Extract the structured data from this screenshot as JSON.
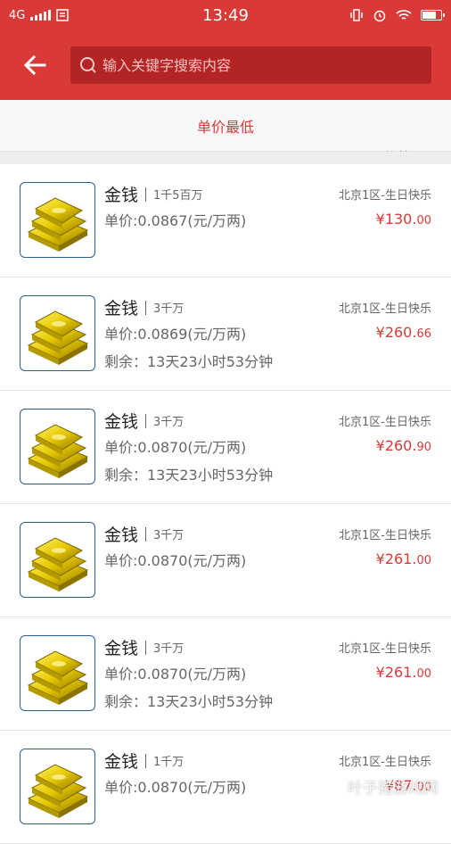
{
  "status_bar": {
    "network": "4G",
    "time": "13:49"
  },
  "search": {
    "placeholder": "输入关键字搜索内容"
  },
  "sort": {
    "lowest_label": "单价最低",
    "price_label": "价格"
  },
  "colors": {
    "primary": "#d93a37",
    "primary_dark": "#b32424",
    "price": "#d93a37"
  },
  "items": [
    {
      "name": "金钱",
      "qty": "1千5百万",
      "server": "北京1区-生日快乐",
      "unit_price": "单价:0.0867(元/万两)",
      "price_main": "¥130.",
      "price_cents": "00",
      "remain": ""
    },
    {
      "name": "金钱",
      "qty": "3千万",
      "server": "北京1区-生日快乐",
      "unit_price": "单价:0.0869(元/万两)",
      "price_main": "¥260.",
      "price_cents": "66",
      "remain": "剩余：13天23小时53分钟"
    },
    {
      "name": "金钱",
      "qty": "3千万",
      "server": "北京1区-生日快乐",
      "unit_price": "单价:0.0870(元/万两)",
      "price_main": "¥260.",
      "price_cents": "90",
      "remain": "剩余：13天23小时53分钟"
    },
    {
      "name": "金钱",
      "qty": "3千万",
      "server": "北京1区-生日快乐",
      "unit_price": "单价:0.0870(元/万两)",
      "price_main": "¥261.",
      "price_cents": "00",
      "remain": ""
    },
    {
      "name": "金钱",
      "qty": "3千万",
      "server": "北京1区-生日快乐",
      "unit_price": "单价:0.0870(元/万两)",
      "price_main": "¥261.",
      "price_cents": "00",
      "remain": "剩余：13天23小时53分钟"
    },
    {
      "name": "金钱",
      "qty": "1千万",
      "server": "北京1区-生日快乐",
      "unit_price": "单价:0.0870(元/万两)",
      "price_main": "¥87.",
      "price_cents": "00",
      "remain": ""
    }
  ],
  "watermark": "叶子猪游戏网"
}
